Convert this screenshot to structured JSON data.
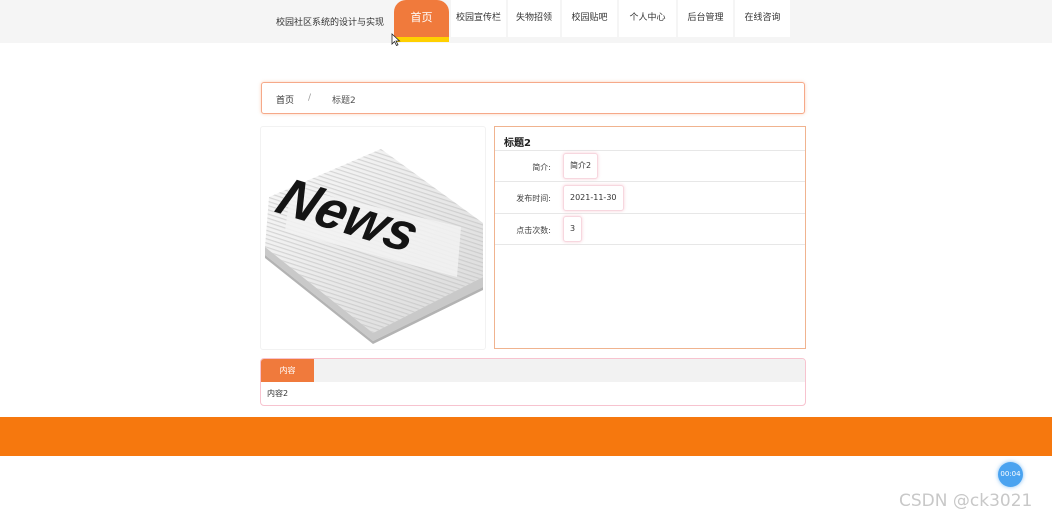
{
  "site": {
    "title": "校园社区系统的设计与实现"
  },
  "nav": {
    "items": [
      {
        "label": "首页"
      },
      {
        "label": "校园宣传栏"
      },
      {
        "label": "失物招领"
      },
      {
        "label": "校园贴吧"
      },
      {
        "label": "个人中心"
      },
      {
        "label": "后台管理"
      },
      {
        "label": "在线咨询"
      }
    ],
    "active_color": "#f07a3c",
    "active_indicator_color": "#ffd000"
  },
  "breadcrumb": {
    "home": "首页",
    "separator": "/",
    "current": "标题2"
  },
  "image": {
    "alt": "News",
    "word": "News"
  },
  "detail": {
    "title": "标题2",
    "rows": [
      {
        "label": "简介:",
        "value": "简介2"
      },
      {
        "label": "发布时间:",
        "value": "2021-11-30"
      },
      {
        "label": "点击次数:",
        "value": "3"
      }
    ]
  },
  "content": {
    "tab_label": "内容",
    "text": "内容2"
  },
  "footer": {
    "color": "#f6780e"
  },
  "overlay": {
    "timer": "00:04",
    "watermark": "CSDN @ck3021"
  }
}
